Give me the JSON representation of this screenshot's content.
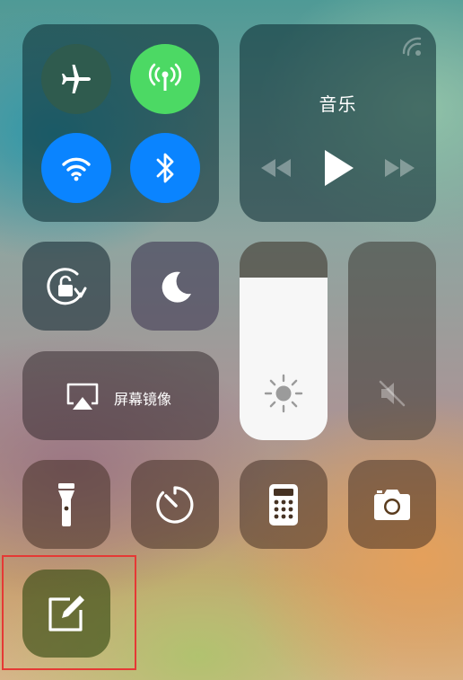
{
  "control_center": {
    "connectivity": {
      "airplane_mode": {
        "icon": "airplane-icon",
        "state": "off",
        "color": "#2f5b4e"
      },
      "cellular_data": {
        "icon": "antenna-icon",
        "state": "on",
        "color": "#4cd964"
      },
      "wifi": {
        "icon": "wifi-icon",
        "state": "on",
        "color": "#0a84ff"
      },
      "bluetooth": {
        "icon": "bluetooth-icon",
        "state": "on",
        "color": "#0a84ff"
      }
    },
    "music": {
      "title": "音乐",
      "airplay_icon": "airplay-audio-icon",
      "rewind_icon": "rewind-icon",
      "play_icon": "play-icon",
      "forward_icon": "fast-forward-icon"
    },
    "orientation_lock": {
      "icon": "orientation-lock-icon"
    },
    "do_not_disturb": {
      "icon": "moon-icon"
    },
    "screen_mirroring": {
      "label": "屏幕镜像",
      "icon": "screen-mirroring-icon"
    },
    "brightness": {
      "icon": "sun-icon",
      "level": 0.82
    },
    "volume": {
      "icon": "speaker-muted-icon",
      "level": 0.0
    },
    "shortcuts": [
      {
        "name": "flashlight",
        "icon": "flashlight-icon"
      },
      {
        "name": "timer",
        "icon": "timer-icon"
      },
      {
        "name": "calculator",
        "icon": "calculator-icon"
      },
      {
        "name": "camera",
        "icon": "camera-icon"
      }
    ],
    "notes": {
      "icon": "note-compose-icon",
      "highlighted": true,
      "highlight_color": "#e53935"
    }
  }
}
